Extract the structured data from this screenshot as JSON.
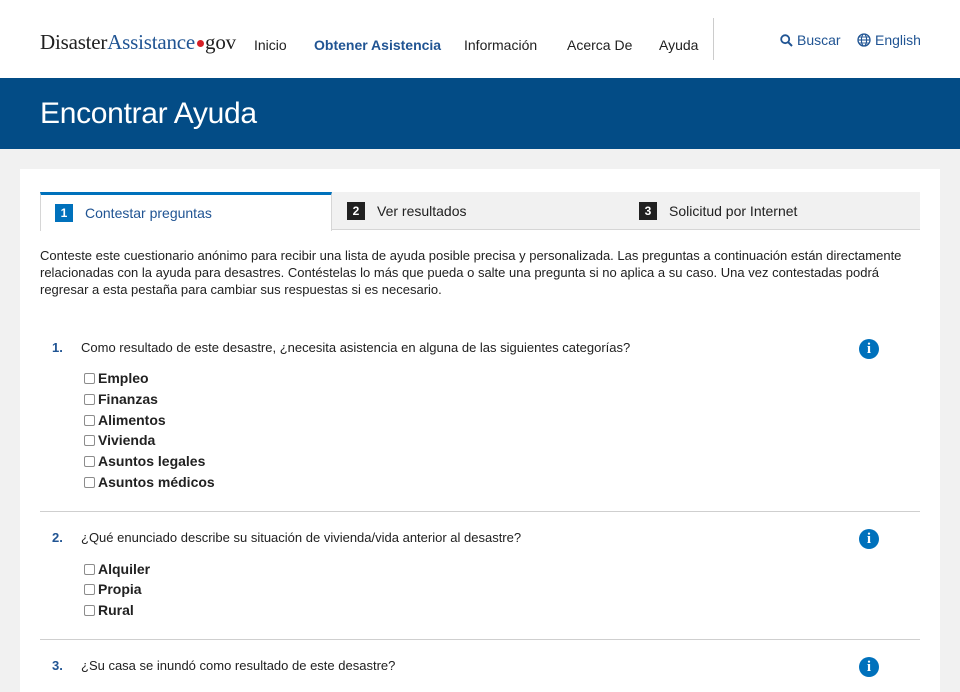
{
  "header": {
    "logo": {
      "part1": "Disaster",
      "part2": "Assistance",
      "part3": "gov"
    },
    "nav": [
      "Inicio",
      "Obtener Asistencia",
      "Información",
      "Acerca De",
      "Ayuda"
    ],
    "search_label": "Buscar",
    "language_label": "English"
  },
  "banner": {
    "title": "Encontrar Ayuda"
  },
  "tabs": [
    {
      "num": "1",
      "label": "Contestar preguntas"
    },
    {
      "num": "2",
      "label": "Ver resultados"
    },
    {
      "num": "3",
      "label": "Solicitud por Internet"
    }
  ],
  "intro": "Conteste este cuestionario anónimo para recibir una lista de ayuda posible precisa y personalizada. Las preguntas a continuación están directamente relacionadas con la ayuda para desastres. Contéstelas lo más que pueda o salte una pregunta si no aplica a su caso. Una vez contestadas podrá regresar a esta pestaña para cambiar sus respuestas si es necesario.",
  "questions": [
    {
      "num": "1.",
      "text": "Como resultado de este desastre, ¿necesita asistencia en alguna de las siguientes categorías?",
      "options": [
        "Empleo",
        "Finanzas",
        "Alimentos",
        "Vivienda",
        "Asuntos legales",
        "Asuntos médicos"
      ]
    },
    {
      "num": "2.",
      "text": "¿Qué enunciado describe su situación de vivienda/vida anterior al desastre?",
      "options": [
        "Alquiler",
        "Propia",
        "Rural"
      ]
    },
    {
      "num": "3.",
      "text": "¿Su casa se inundó como resultado de este desastre?",
      "options": []
    }
  ],
  "info_icon_glyph": "i",
  "colors": {
    "brand_blue": "#205493",
    "banner": "#034c86",
    "accent": "#0071bc",
    "logo_dot": "#d61f26"
  }
}
